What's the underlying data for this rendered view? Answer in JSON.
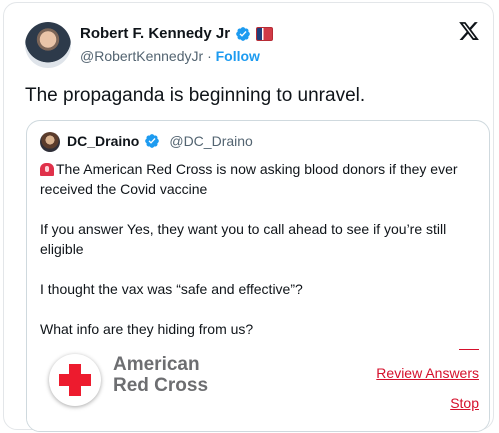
{
  "author": {
    "name": "Robert F. Kennedy Jr",
    "handle": "@RobertKennedyJr",
    "separator": "·",
    "follow_label": "Follow"
  },
  "tweet": {
    "text": "The propaganda is beginning to unravel."
  },
  "quoted": {
    "name": "DC_Draino",
    "handle": "@DC_Draino",
    "paragraphs": [
      "The American Red Cross is now asking blood donors if they ever received the Covid vaccine",
      "If you answer Yes, they want you to call ahead to see if you’re still eligible",
      "I thought the vax was “safe and effective”?",
      "What info are they hiding from us?"
    ],
    "image": {
      "logo_line1": "American",
      "logo_line2": "Red Cross",
      "review_answers_label": "Review Answers",
      "stop_label": "Stop"
    }
  },
  "icons": {
    "verified": "verified-badge-icon",
    "flag": "flag-icon",
    "x_logo": "x-logo-icon",
    "siren": "siren-emoji-icon"
  },
  "colors": {
    "verified_blue": "#1d9bf0",
    "red_cross": "#ed1b2e",
    "link_red": "#d5102c"
  }
}
